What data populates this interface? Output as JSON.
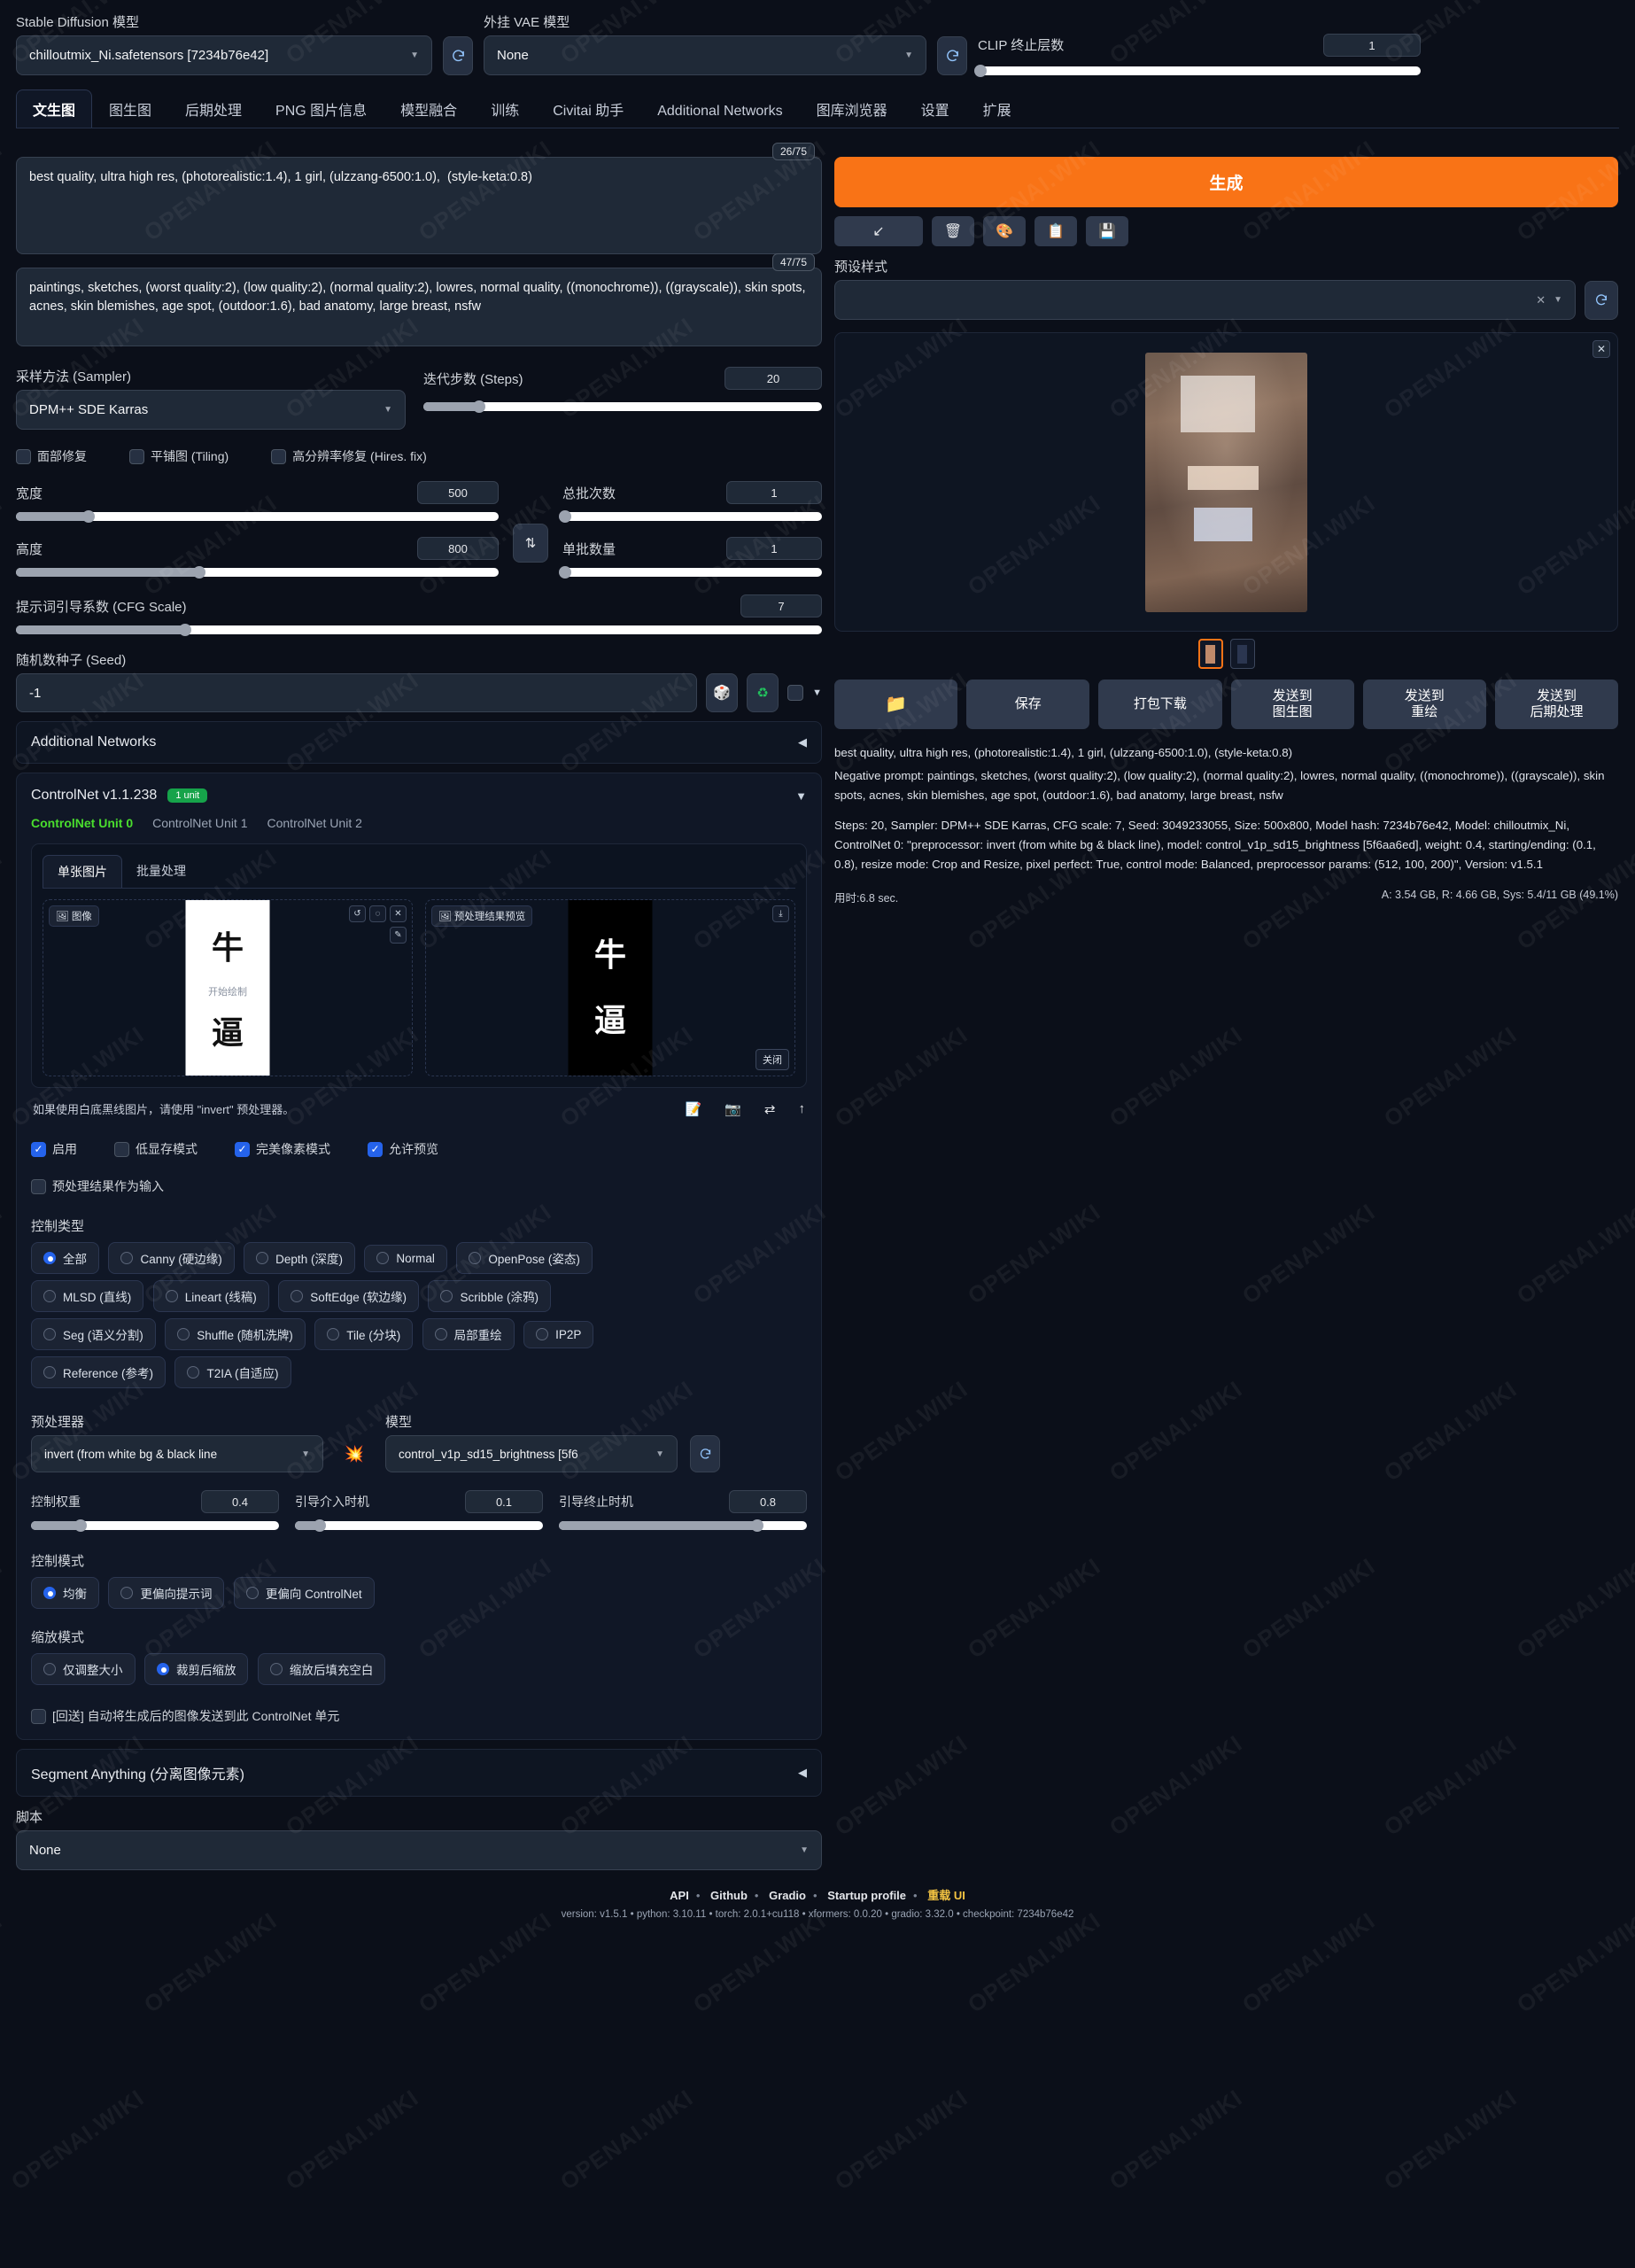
{
  "header": {
    "sd_model_label": "Stable Diffusion 模型",
    "sd_model_value": "chilloutmix_Ni.safetensors [7234b76e42]",
    "vae_label": "外挂 VAE 模型",
    "vae_value": "None",
    "clip_label": "CLIP 终止层数",
    "clip_value": "1",
    "refresh_icon": "refresh-icon"
  },
  "tabs": [
    {
      "label": "文生图",
      "active": true
    },
    {
      "label": "图生图",
      "active": false
    },
    {
      "label": "后期处理",
      "active": false
    },
    {
      "label": "PNG 图片信息",
      "active": false
    },
    {
      "label": "模型融合",
      "active": false
    },
    {
      "label": "训练",
      "active": false
    },
    {
      "label": "Civitai 助手",
      "active": false
    },
    {
      "label": "Additional Networks",
      "active": false
    },
    {
      "label": "图库浏览器",
      "active": false
    },
    {
      "label": "设置",
      "active": false
    },
    {
      "label": "扩展",
      "active": false
    }
  ],
  "prompt": {
    "positive": "best quality, ultra high res, (photorealistic:1.4), 1 girl, (ulzzang-6500:1.0),  (style-keta:0.8)",
    "positive_counter": "26/75",
    "negative": "paintings, sketches, (worst quality:2), (low quality:2), (normal quality:2), lowres, normal quality, ((monochrome)), ((grayscale)), skin spots, acnes, skin blemishes, age spot, (outdoor:1.6), bad anatomy, large breast, nsfw",
    "negative_counter": "47/75"
  },
  "params": {
    "sampler_label": "采样方法 (Sampler)",
    "sampler_value": "DPM++ SDE Karras",
    "steps_label": "迭代步数 (Steps)",
    "steps_value": "20",
    "restore_faces": "面部修复",
    "tiling": "平铺图 (Tiling)",
    "hires_fix": "高分辨率修复 (Hires. fix)",
    "width_label": "宽度",
    "width_value": "500",
    "height_label": "高度",
    "height_value": "800",
    "batch_count_label": "总批次数",
    "batch_count_value": "1",
    "batch_size_label": "单批数量",
    "batch_size_value": "1",
    "cfg_label": "提示词引导系数 (CFG Scale)",
    "cfg_value": "7",
    "seed_label": "随机数种子 (Seed)",
    "seed_value": "-1",
    "swap_icon": "swap-dimensions-icon",
    "dice_icon": "dice-icon",
    "recycle_icon": "recycle-icon"
  },
  "accordions": {
    "additional_networks": "Additional Networks",
    "segment_anything": "Segment Anything (分离图像元素)"
  },
  "controlnet": {
    "title": "ControlNet v1.1.238",
    "badge": "1 unit",
    "units": [
      {
        "label": "ControlNet Unit 0",
        "active": true
      },
      {
        "label": "ControlNet Unit 1",
        "active": false
      },
      {
        "label": "ControlNet Unit 2",
        "active": false
      }
    ],
    "img_tabs": [
      {
        "label": "单张图片",
        "active": true
      },
      {
        "label": "批量处理",
        "active": false
      }
    ],
    "image_pane_label": "图像",
    "image_pane_hint": "开始绘制",
    "image_char_top": "牛",
    "image_char_bottom": "逼",
    "preview_pane_label": "预处理结果预览",
    "preview_close": "关闭",
    "hint": "如果使用白底黑线图片，请使用 \"invert\" 预处理器。",
    "checkboxes": [
      {
        "label": "启用",
        "checked": true
      },
      {
        "label": "低显存模式",
        "checked": false
      },
      {
        "label": "完美像素模式",
        "checked": true
      },
      {
        "label": "允许预览",
        "checked": true
      }
    ],
    "pre_as_input": {
      "label": "预处理结果作为输入",
      "checked": false
    },
    "control_type_label": "控制类型",
    "control_types": [
      {
        "label": "全部",
        "selected": true
      },
      {
        "label": "Canny (硬边缘)",
        "selected": false
      },
      {
        "label": "Depth (深度)",
        "selected": false
      },
      {
        "label": "Normal",
        "selected": false
      },
      {
        "label": "OpenPose (姿态)",
        "selected": false
      },
      {
        "label": "MLSD (直线)",
        "selected": false
      },
      {
        "label": "Lineart (线稿)",
        "selected": false
      },
      {
        "label": "SoftEdge (软边缘)",
        "selected": false
      },
      {
        "label": "Scribble (涂鸦)",
        "selected": false
      },
      {
        "label": "Seg (语义分割)",
        "selected": false
      },
      {
        "label": "Shuffle (随机洗牌)",
        "selected": false
      },
      {
        "label": "Tile (分块)",
        "selected": false
      },
      {
        "label": "局部重绘",
        "selected": false
      },
      {
        "label": "IP2P",
        "selected": false
      },
      {
        "label": "Reference (参考)",
        "selected": false
      },
      {
        "label": "T2IA (自适应)",
        "selected": false
      }
    ],
    "preprocessor_label": "预处理器",
    "preprocessor_value": "invert (from white bg & black line",
    "model_label": "模型",
    "model_value": "control_v1p_sd15_brightness [5f6",
    "weight_label": "控制权重",
    "weight_value": "0.4",
    "start_label": "引导介入时机",
    "start_value": "0.1",
    "end_label": "引导终止时机",
    "end_value": "0.8",
    "control_mode_label": "控制模式",
    "control_modes": [
      {
        "label": "均衡",
        "selected": true
      },
      {
        "label": "更偏向提示词",
        "selected": false
      },
      {
        "label": "更偏向 ControlNet",
        "selected": false
      }
    ],
    "resize_mode_label": "缩放模式",
    "resize_modes": [
      {
        "label": "仅调整大小",
        "selected": false
      },
      {
        "label": "裁剪后缩放",
        "selected": true
      },
      {
        "label": "缩放后填充空白",
        "selected": false
      }
    ],
    "loopback": {
      "label": "[回送] 自动将生成后的图像发送到此 ControlNet 单元",
      "checked": false
    }
  },
  "script": {
    "label": "脚本",
    "value": "None"
  },
  "right": {
    "generate_label": "生成",
    "icon_buttons": [
      {
        "name": "arrow-down-left-icon",
        "glyph": "↙"
      },
      {
        "name": "trash-icon",
        "glyph": "🗑"
      },
      {
        "name": "palette-icon",
        "glyph": "🎨"
      },
      {
        "name": "clipboard-icon",
        "glyph": "📋"
      },
      {
        "name": "save-style-icon",
        "glyph": "💾"
      }
    ],
    "styles_label": "预设样式",
    "styles_value": "",
    "clear_icon": "clear-icon",
    "refresh_icon": "refresh-icon",
    "close_icon": "close-icon",
    "thumbnails": [
      {
        "name": "image-thumb-1",
        "selected": true
      },
      {
        "name": "image-thumb-2",
        "selected": false
      }
    ],
    "action_buttons": [
      {
        "name": "open-folder-button",
        "label": "",
        "icon": "folder-icon"
      },
      {
        "name": "save-button",
        "label": "保存"
      },
      {
        "name": "zip-download-button",
        "label": "打包下载"
      },
      {
        "name": "send-to-img2img-button",
        "label": "发送到\n图生图"
      },
      {
        "name": "send-to-inpaint-button",
        "label": "发送到\n重绘"
      },
      {
        "name": "send-to-extras-button",
        "label": "发送到\n后期处理"
      }
    ],
    "info_lines": [
      "best quality, ultra high res, (photorealistic:1.4), 1 girl, (ulzzang-6500:1.0), (style-keta:0.8)",
      "Negative prompt: paintings, sketches, (worst quality:2), (low quality:2), (normal quality:2), lowres, normal quality, ((monochrome)), ((grayscale)), skin spots, acnes, skin blemishes, age spot, (outdoor:1.6), bad anatomy, large breast, nsfw",
      "Steps: 20, Sampler: DPM++ SDE Karras, CFG scale: 7, Seed: 3049233055, Size: 500x800, Model hash: 7234b76e42, Model: chilloutmix_Ni, ControlNet 0: \"preprocessor: invert (from white bg & black line), model: control_v1p_sd15_brightness [5f6aa6ed], weight: 0.4, starting/ending: (0.1, 0.8), resize mode: Crop and Resize, pixel perfect: True, control mode: Balanced, preprocessor params: (512, 100, 200)\", Version: v1.5.1"
    ],
    "elapsed": "用时:6.8 sec.",
    "memory": "A: 3.54 GB, R: 4.66 GB, Sys: 5.4/11 GB (49.1%)"
  },
  "footer": {
    "links": [
      "API",
      "Github",
      "Gradio",
      "Startup profile",
      "重载 UI"
    ],
    "version_line": "version: v1.5.1  •  python: 3.10.11  •  torch: 2.0.1+cu118  •  xformers: 0.0.20  •  gradio: 3.32.0  •  checkpoint: 7234b76e42"
  },
  "watermark": "OPENAI.WIKI",
  "colors": {
    "accent_orange": "#f97316",
    "accent_blue": "#2563eb",
    "accent_green": "#16a34a",
    "unit_active_green": "#4ade2e",
    "background": "#0b0f19"
  }
}
